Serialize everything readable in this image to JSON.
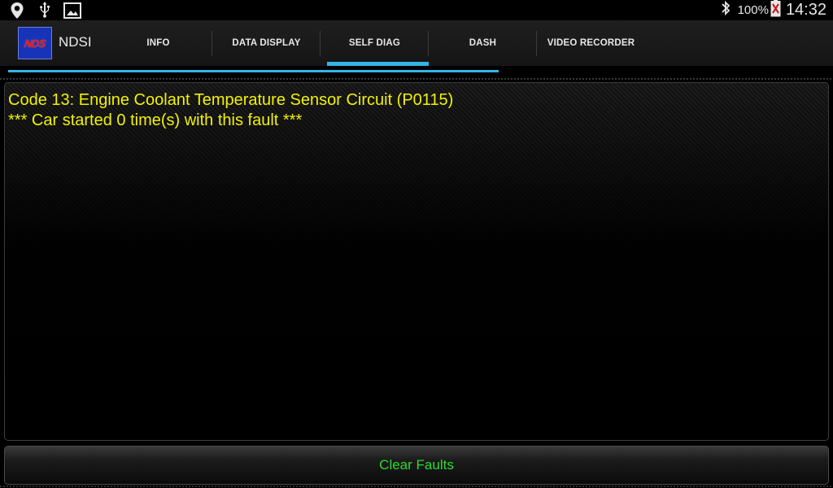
{
  "status_bar": {
    "icons": [
      "location-icon",
      "usb-icon",
      "gallery-icon",
      "bluetooth-icon",
      "battery-icon"
    ],
    "battery": "100%",
    "time": "14:32"
  },
  "app": {
    "logo_text": "NDS",
    "title": "NDSI"
  },
  "tabs": [
    {
      "label": "INFO",
      "selected": false
    },
    {
      "label": "DATA DISPLAY",
      "selected": false
    },
    {
      "label": "SELF DIAG",
      "selected": true
    },
    {
      "label": "DASH",
      "selected": false
    },
    {
      "label": "VIDEO RECORDER",
      "selected": false
    }
  ],
  "faults": {
    "lines": [
      "Code 13: Engine Coolant Temperature Sensor Circuit (P0115)",
      "*** Car started 0 time(s) with this fault ***"
    ]
  },
  "actions": {
    "clear_label": "Clear Faults"
  },
  "colors": {
    "accent": "#33b5e5",
    "fault_text": "#f2f200",
    "button_text": "#2cdc2c",
    "logo_bg": "#1733b8",
    "logo_text": "#e01818"
  }
}
